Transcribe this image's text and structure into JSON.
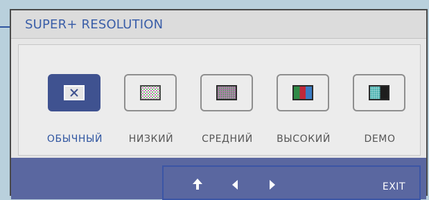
{
  "title": "SUPER+ RESOLUTION",
  "options": [
    {
      "label": "ОБЫЧНЫЙ",
      "selected": true,
      "icon": "close-icon"
    },
    {
      "label": "НИЗКИЙ",
      "selected": false,
      "icon": "pattern-low-icon"
    },
    {
      "label": "СРЕДНИЙ",
      "selected": false,
      "icon": "pattern-medium-icon"
    },
    {
      "label": "ВЫСОКИЙ",
      "selected": false,
      "icon": "color-bars-high-icon"
    },
    {
      "label": "DEMO",
      "selected": false,
      "icon": "demo-split-icon"
    }
  ],
  "footer": {
    "icons": [
      "up-arrow-icon",
      "left-arrow-icon",
      "right-arrow-icon"
    ],
    "exit_label": "EXIT"
  },
  "colors": {
    "accent": "#3f5290",
    "title_text": "#3a5ea8",
    "footer_bg": "#5a67a0",
    "nav_border": "#3b55a5"
  }
}
